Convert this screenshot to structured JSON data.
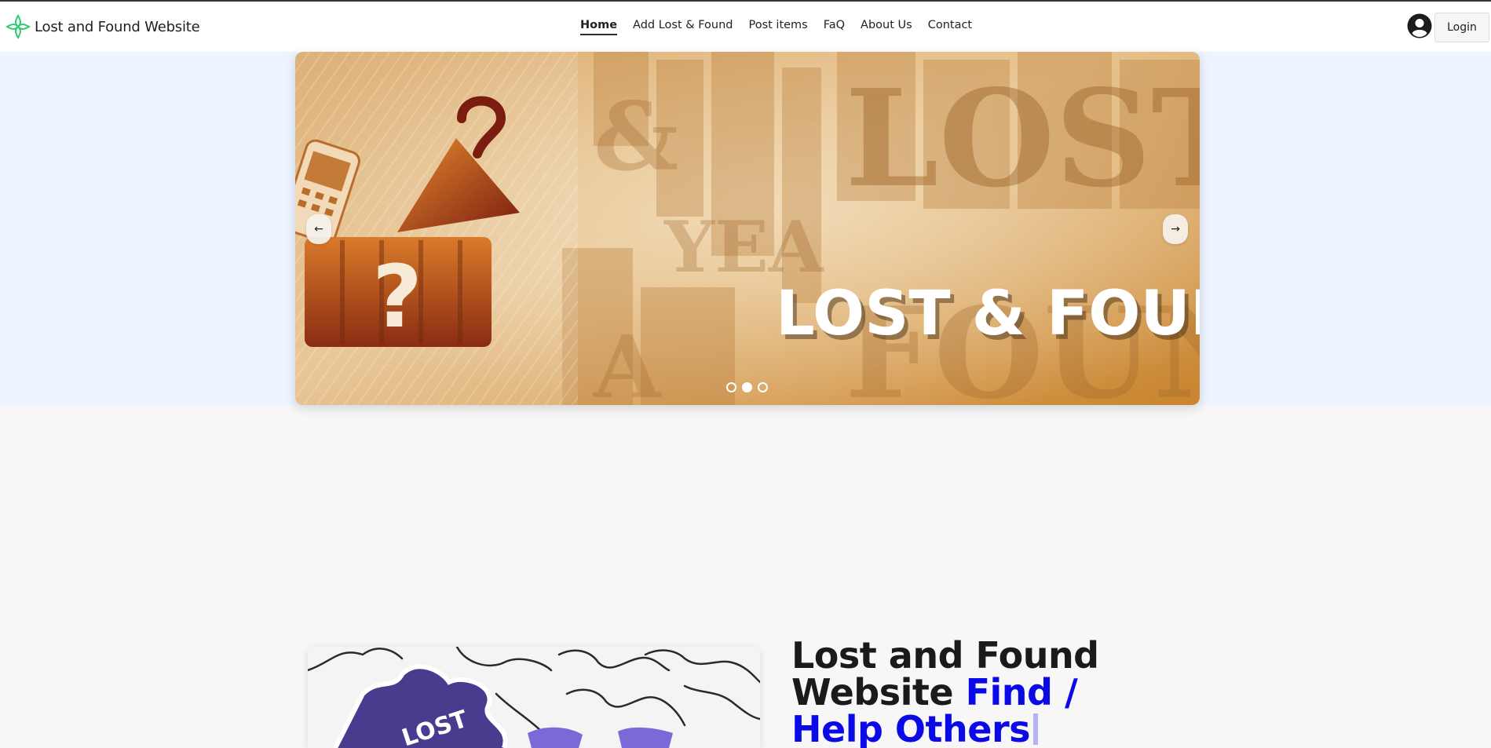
{
  "navbar": {
    "brand_text": "Lost and Found Website",
    "links": [
      {
        "label": "Home",
        "active": true
      },
      {
        "label": "Add Lost & Found",
        "active": false
      },
      {
        "label": "Post items",
        "active": false
      },
      {
        "label": "FaQ",
        "active": false
      },
      {
        "label": "About Us",
        "active": false
      },
      {
        "label": "Contact",
        "active": false
      }
    ],
    "login_label": "Login",
    "user_icon": "user-circle-icon",
    "logo_icon": "clover-logo-icon",
    "logo_color": "#2ecc71"
  },
  "hero": {
    "background_color": "#edf4ff",
    "slide_text": "LOST & FOUN",
    "prev_label": "←",
    "next_label": "→",
    "slide_count": 3,
    "active_slide": 2
  },
  "intro": {
    "headline_plain": "Lost and Found Website ",
    "headline_accent": "Find / Help Others",
    "accent_color": "#0a0ae6",
    "puzzle_text": "LOST"
  }
}
